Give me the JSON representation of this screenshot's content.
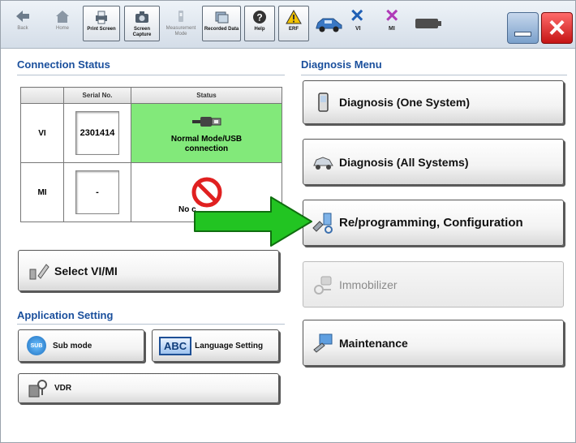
{
  "toolbar": {
    "back": "Back",
    "home": "Home",
    "print_screen": "Print Screen",
    "screen_capture": "Screen Capture",
    "measurement_mode": "Measurement Mode",
    "recorded_data": "Recorded Data",
    "help": "Help",
    "erf": "ERF",
    "vi": "VI",
    "mi": "MI"
  },
  "connection": {
    "title": "Connection Status",
    "headers": {
      "serial": "Serial No.",
      "status": "Status"
    },
    "rows": [
      {
        "label": "VI",
        "serial": "2301414",
        "status": "Normal Mode/USB connection"
      },
      {
        "label": "MI",
        "serial": "-",
        "status": "No c"
      }
    ]
  },
  "select_vimi": "Select VI/MI",
  "application": {
    "title": "Application Setting",
    "sub_mode": "Sub mode",
    "sub_icon": "SUB",
    "language": "Language Setting",
    "abc": "ABC",
    "vdr": "VDR"
  },
  "diagnosis": {
    "title": "Diagnosis Menu",
    "one_system": "Diagnosis (One System)",
    "all_systems": "Diagnosis (All Systems)",
    "reprogramming": "Re/programming, Configuration",
    "immobilizer": "Immobilizer",
    "maintenance": "Maintenance"
  },
  "colors": {
    "status_ok": "#82e97a",
    "arrow": "#22c422",
    "section_title": "#1a4f9c",
    "close": "#d01c1c"
  }
}
